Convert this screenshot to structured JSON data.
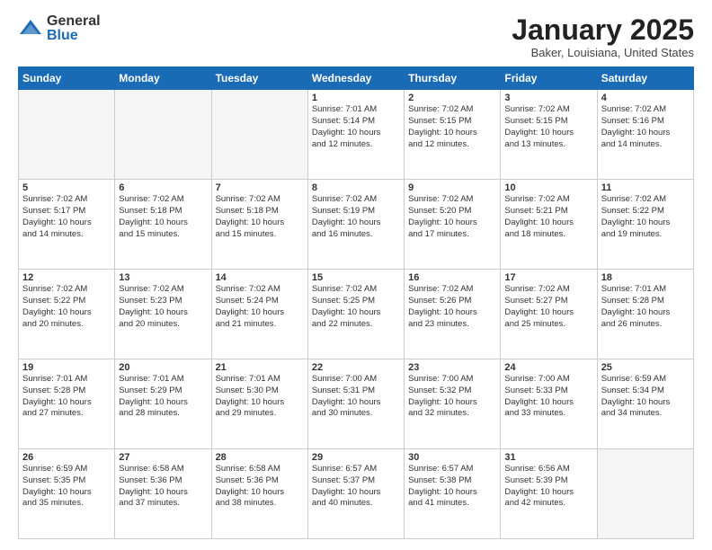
{
  "header": {
    "logo_general": "General",
    "logo_blue": "Blue",
    "month_title": "January 2025",
    "location": "Baker, Louisiana, United States"
  },
  "days_of_week": [
    "Sunday",
    "Monday",
    "Tuesday",
    "Wednesday",
    "Thursday",
    "Friday",
    "Saturday"
  ],
  "weeks": [
    [
      {
        "day": "",
        "info": ""
      },
      {
        "day": "",
        "info": ""
      },
      {
        "day": "",
        "info": ""
      },
      {
        "day": "1",
        "info": "Sunrise: 7:01 AM\nSunset: 5:14 PM\nDaylight: 10 hours\nand 12 minutes."
      },
      {
        "day": "2",
        "info": "Sunrise: 7:02 AM\nSunset: 5:15 PM\nDaylight: 10 hours\nand 12 minutes."
      },
      {
        "day": "3",
        "info": "Sunrise: 7:02 AM\nSunset: 5:15 PM\nDaylight: 10 hours\nand 13 minutes."
      },
      {
        "day": "4",
        "info": "Sunrise: 7:02 AM\nSunset: 5:16 PM\nDaylight: 10 hours\nand 14 minutes."
      }
    ],
    [
      {
        "day": "5",
        "info": "Sunrise: 7:02 AM\nSunset: 5:17 PM\nDaylight: 10 hours\nand 14 minutes."
      },
      {
        "day": "6",
        "info": "Sunrise: 7:02 AM\nSunset: 5:18 PM\nDaylight: 10 hours\nand 15 minutes."
      },
      {
        "day": "7",
        "info": "Sunrise: 7:02 AM\nSunset: 5:18 PM\nDaylight: 10 hours\nand 15 minutes."
      },
      {
        "day": "8",
        "info": "Sunrise: 7:02 AM\nSunset: 5:19 PM\nDaylight: 10 hours\nand 16 minutes."
      },
      {
        "day": "9",
        "info": "Sunrise: 7:02 AM\nSunset: 5:20 PM\nDaylight: 10 hours\nand 17 minutes."
      },
      {
        "day": "10",
        "info": "Sunrise: 7:02 AM\nSunset: 5:21 PM\nDaylight: 10 hours\nand 18 minutes."
      },
      {
        "day": "11",
        "info": "Sunrise: 7:02 AM\nSunset: 5:22 PM\nDaylight: 10 hours\nand 19 minutes."
      }
    ],
    [
      {
        "day": "12",
        "info": "Sunrise: 7:02 AM\nSunset: 5:22 PM\nDaylight: 10 hours\nand 20 minutes."
      },
      {
        "day": "13",
        "info": "Sunrise: 7:02 AM\nSunset: 5:23 PM\nDaylight: 10 hours\nand 20 minutes."
      },
      {
        "day": "14",
        "info": "Sunrise: 7:02 AM\nSunset: 5:24 PM\nDaylight: 10 hours\nand 21 minutes."
      },
      {
        "day": "15",
        "info": "Sunrise: 7:02 AM\nSunset: 5:25 PM\nDaylight: 10 hours\nand 22 minutes."
      },
      {
        "day": "16",
        "info": "Sunrise: 7:02 AM\nSunset: 5:26 PM\nDaylight: 10 hours\nand 23 minutes."
      },
      {
        "day": "17",
        "info": "Sunrise: 7:02 AM\nSunset: 5:27 PM\nDaylight: 10 hours\nand 25 minutes."
      },
      {
        "day": "18",
        "info": "Sunrise: 7:01 AM\nSunset: 5:28 PM\nDaylight: 10 hours\nand 26 minutes."
      }
    ],
    [
      {
        "day": "19",
        "info": "Sunrise: 7:01 AM\nSunset: 5:28 PM\nDaylight: 10 hours\nand 27 minutes."
      },
      {
        "day": "20",
        "info": "Sunrise: 7:01 AM\nSunset: 5:29 PM\nDaylight: 10 hours\nand 28 minutes."
      },
      {
        "day": "21",
        "info": "Sunrise: 7:01 AM\nSunset: 5:30 PM\nDaylight: 10 hours\nand 29 minutes."
      },
      {
        "day": "22",
        "info": "Sunrise: 7:00 AM\nSunset: 5:31 PM\nDaylight: 10 hours\nand 30 minutes."
      },
      {
        "day": "23",
        "info": "Sunrise: 7:00 AM\nSunset: 5:32 PM\nDaylight: 10 hours\nand 32 minutes."
      },
      {
        "day": "24",
        "info": "Sunrise: 7:00 AM\nSunset: 5:33 PM\nDaylight: 10 hours\nand 33 minutes."
      },
      {
        "day": "25",
        "info": "Sunrise: 6:59 AM\nSunset: 5:34 PM\nDaylight: 10 hours\nand 34 minutes."
      }
    ],
    [
      {
        "day": "26",
        "info": "Sunrise: 6:59 AM\nSunset: 5:35 PM\nDaylight: 10 hours\nand 35 minutes."
      },
      {
        "day": "27",
        "info": "Sunrise: 6:58 AM\nSunset: 5:36 PM\nDaylight: 10 hours\nand 37 minutes."
      },
      {
        "day": "28",
        "info": "Sunrise: 6:58 AM\nSunset: 5:36 PM\nDaylight: 10 hours\nand 38 minutes."
      },
      {
        "day": "29",
        "info": "Sunrise: 6:57 AM\nSunset: 5:37 PM\nDaylight: 10 hours\nand 40 minutes."
      },
      {
        "day": "30",
        "info": "Sunrise: 6:57 AM\nSunset: 5:38 PM\nDaylight: 10 hours\nand 41 minutes."
      },
      {
        "day": "31",
        "info": "Sunrise: 6:56 AM\nSunset: 5:39 PM\nDaylight: 10 hours\nand 42 minutes."
      },
      {
        "day": "",
        "info": ""
      }
    ]
  ]
}
